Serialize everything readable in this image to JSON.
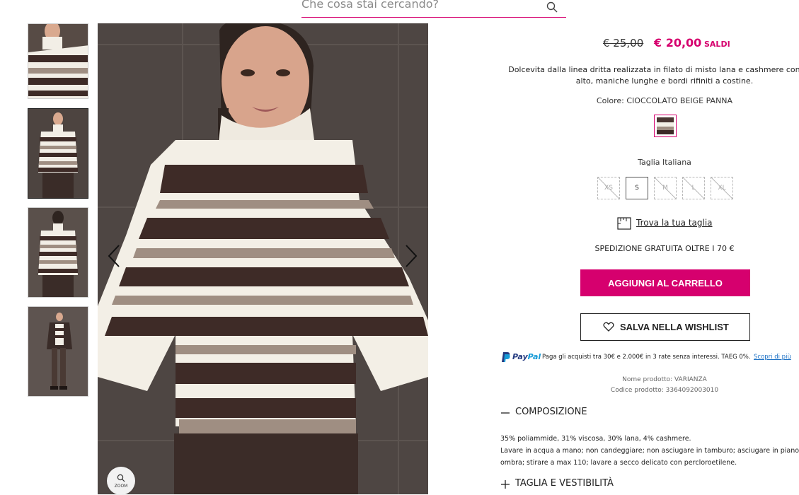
{
  "search": {
    "placeholder": "Che cosa stai cercando?"
  },
  "gallery": {
    "thumbnails": [
      "Vista frontale ravvicinata",
      "Vista frontale",
      "Vista posteriore",
      "Vista completa"
    ],
    "zoom_label": "ZOOM"
  },
  "product": {
    "old_price": "€ 25,00",
    "new_price": "€ 20,00",
    "sale_badge": "SALDI",
    "description": "Dolcevita dalla linea dritta realizzata in filato di misto lana e cashmere con collo alto, maniche lunghe e bordi rifiniti a costine.",
    "color_label": "Colore:",
    "color_value": "CIOCCOLATO BEIGE PANNA",
    "size_title": "Taglia Italiana",
    "sizes": [
      {
        "label": "XS",
        "available": false
      },
      {
        "label": "S",
        "available": true
      },
      {
        "label": "M",
        "available": false
      },
      {
        "label": "L",
        "available": false
      },
      {
        "label": "XL",
        "available": false
      }
    ],
    "size_guide": "Trova la tua taglia",
    "shipping": "SPEDIZIONE GRATUITA OLTRE I 70 €",
    "add_to_cart": "AGGIUNGI AL CARRELLO",
    "wishlist": "SALVA NELLA WISHLIST"
  },
  "paypal": {
    "brand_a": "Pay",
    "brand_b": "Pal",
    "text": "Paga gli acquisti tra 30€ e 2.000€ in 3 rate senza interessi. TAEG 0%.",
    "link": "Scopri di più"
  },
  "product_info": {
    "name_label": "Nome prodotto: VARIANZA",
    "code_label": "Codice prodotto:  3364092003010"
  },
  "accordion": {
    "composition_title": "COMPOSIZIONE",
    "composition_line1": "35% poliammide, 31% viscosa, 30% lana, 4% cashmere.",
    "composition_line2": "Lavare in acqua a mano; non candeggiare; non asciugare in tamburo; asciugare in piano all'",
    "composition_line3": "ombra; stirare a max 110; lavare a secco delicato con percloroetilene.",
    "fit_title": "TAGLIA E VESTIBILITÀ"
  },
  "colors": {
    "accent": "#d6006e",
    "paypal_dark": "#253b80",
    "paypal_light": "#179bd7"
  },
  "icons": [
    "search-icon",
    "chevron-left-icon",
    "chevron-right-icon",
    "zoom-icon",
    "ruler-icon",
    "heart-icon",
    "paypal-icon",
    "minus-icon",
    "plus-icon"
  ]
}
